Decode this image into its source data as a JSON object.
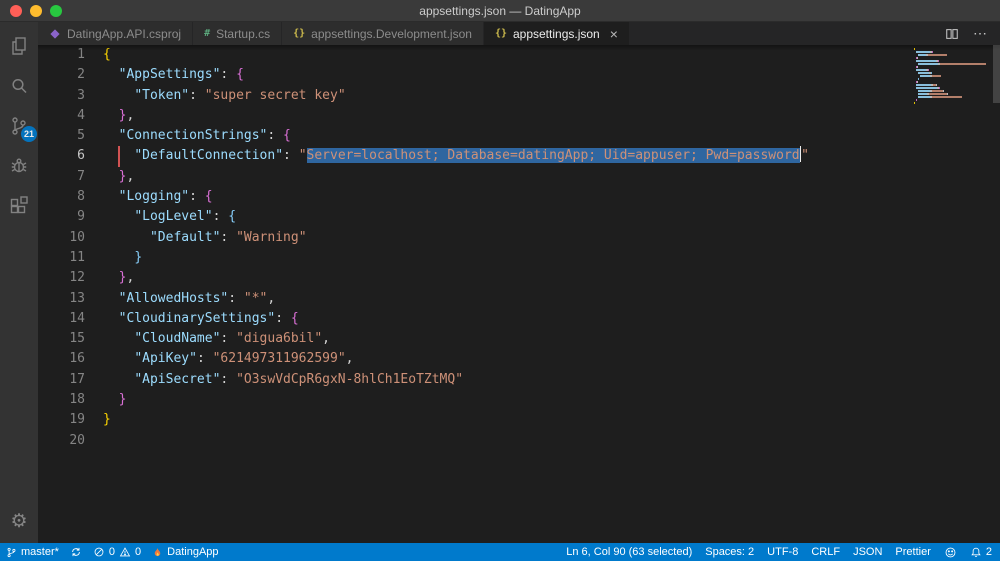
{
  "window": {
    "title": "appsettings.json — DatingApp"
  },
  "icons": {
    "json_glyph": "{}",
    "csharp_glyph": "#",
    "close_glyph": "×",
    "more_glyph": "⋯",
    "gear_glyph": "⚙"
  },
  "activity_bar": {
    "scm_badge": "21"
  },
  "tabs": [
    {
      "label": "DatingApp.API.csproj"
    },
    {
      "label": "Startup.cs"
    },
    {
      "label": "appsettings.Development.json"
    },
    {
      "label": "appsettings.json"
    }
  ],
  "colors": {
    "k": "#9cdcfe",
    "s": "#ce9178",
    "p": "#d4d4d4",
    "b1": "#ffd700",
    "b2": "#da70d6",
    "b3": "#87cefa",
    "selection": "#2f66a0",
    "accent": "#007acc"
  },
  "editor": {
    "active_line": 6,
    "lines": [
      {
        "tokens": [
          {
            "t": "{",
            "c": "b1"
          }
        ]
      },
      {
        "tokens": [
          {
            "t": "  ",
            "c": "p"
          },
          {
            "t": "\"AppSettings\"",
            "c": "k"
          },
          {
            "t": ": ",
            "c": "p"
          },
          {
            "t": "{",
            "c": "b2"
          }
        ]
      },
      {
        "tokens": [
          {
            "t": "    ",
            "c": "p"
          },
          {
            "t": "\"Token\"",
            "c": "k"
          },
          {
            "t": ": ",
            "c": "p"
          },
          {
            "t": "\"super secret key\"",
            "c": "s"
          }
        ]
      },
      {
        "tokens": [
          {
            "t": "  ",
            "c": "p"
          },
          {
            "t": "}",
            "c": "b2"
          },
          {
            "t": ",",
            "c": "p"
          }
        ]
      },
      {
        "tokens": [
          {
            "t": "  ",
            "c": "p"
          },
          {
            "t": "\"ConnectionStrings\"",
            "c": "k"
          },
          {
            "t": ": ",
            "c": "p"
          },
          {
            "t": "{",
            "c": "b2"
          }
        ]
      },
      {
        "tokens": [
          {
            "t": "    ",
            "c": "p"
          },
          {
            "t": "\"DefaultConnection\"",
            "c": "k"
          },
          {
            "t": ": ",
            "c": "p"
          },
          {
            "t": "\"",
            "c": "s"
          },
          {
            "t": "Server=localhost; Database=datingApp; Uid=appuser; Pwd=password",
            "c": "s",
            "sel": true
          },
          {
            "cursor": true
          },
          {
            "t": "\"",
            "c": "s"
          }
        ]
      },
      {
        "tokens": [
          {
            "t": "  ",
            "c": "p"
          },
          {
            "t": "}",
            "c": "b2"
          },
          {
            "t": ",",
            "c": "p"
          }
        ]
      },
      {
        "tokens": [
          {
            "t": "  ",
            "c": "p"
          },
          {
            "t": "\"Logging\"",
            "c": "k"
          },
          {
            "t": ": ",
            "c": "p"
          },
          {
            "t": "{",
            "c": "b2"
          }
        ]
      },
      {
        "tokens": [
          {
            "t": "    ",
            "c": "p"
          },
          {
            "t": "\"LogLevel\"",
            "c": "k"
          },
          {
            "t": ": ",
            "c": "p"
          },
          {
            "t": "{",
            "c": "b3"
          }
        ]
      },
      {
        "tokens": [
          {
            "t": "      ",
            "c": "p"
          },
          {
            "t": "\"Default\"",
            "c": "k"
          },
          {
            "t": ": ",
            "c": "p"
          },
          {
            "t": "\"Warning\"",
            "c": "s"
          }
        ]
      },
      {
        "tokens": [
          {
            "t": "    ",
            "c": "p"
          },
          {
            "t": "}",
            "c": "b3"
          }
        ]
      },
      {
        "tokens": [
          {
            "t": "  ",
            "c": "p"
          },
          {
            "t": "}",
            "c": "b2"
          },
          {
            "t": ",",
            "c": "p"
          }
        ]
      },
      {
        "tokens": [
          {
            "t": "  ",
            "c": "p"
          },
          {
            "t": "\"AllowedHosts\"",
            "c": "k"
          },
          {
            "t": ": ",
            "c": "p"
          },
          {
            "t": "\"*\"",
            "c": "s"
          },
          {
            "t": ",",
            "c": "p"
          }
        ]
      },
      {
        "tokens": [
          {
            "t": "  ",
            "c": "p"
          },
          {
            "t": "\"CloudinarySettings\"",
            "c": "k"
          },
          {
            "t": ": ",
            "c": "p"
          },
          {
            "t": "{",
            "c": "b2"
          }
        ]
      },
      {
        "tokens": [
          {
            "t": "    ",
            "c": "p"
          },
          {
            "t": "\"CloudName\"",
            "c": "k"
          },
          {
            "t": ": ",
            "c": "p"
          },
          {
            "t": "\"digua6bil\"",
            "c": "s"
          },
          {
            "t": ",",
            "c": "p"
          }
        ]
      },
      {
        "tokens": [
          {
            "t": "    ",
            "c": "p"
          },
          {
            "t": "\"ApiKey\"",
            "c": "k"
          },
          {
            "t": ": ",
            "c": "p"
          },
          {
            "t": "\"621497311962599\"",
            "c": "s"
          },
          {
            "t": ",",
            "c": "p"
          }
        ]
      },
      {
        "tokens": [
          {
            "t": "    ",
            "c": "p"
          },
          {
            "t": "\"ApiSecret\"",
            "c": "k"
          },
          {
            "t": ": ",
            "c": "p"
          },
          {
            "t": "\"O3swVdCpR6gxN-8hlCh1EoTZtMQ\"",
            "c": "s"
          }
        ]
      },
      {
        "tokens": [
          {
            "t": "  ",
            "c": "p"
          },
          {
            "t": "}",
            "c": "b2"
          }
        ]
      },
      {
        "tokens": [
          {
            "t": "}",
            "c": "b1"
          }
        ]
      },
      {
        "tokens": []
      }
    ]
  },
  "status_bar": {
    "branch": "master*",
    "errors": "0",
    "warnings": "0",
    "project": "DatingApp",
    "line_col": "Ln 6, Col 90 (63 selected)",
    "indentation": "Spaces: 2",
    "encoding": "UTF-8",
    "eol": "CRLF",
    "language": "JSON",
    "formatter": "Prettier",
    "notifications": "2"
  }
}
